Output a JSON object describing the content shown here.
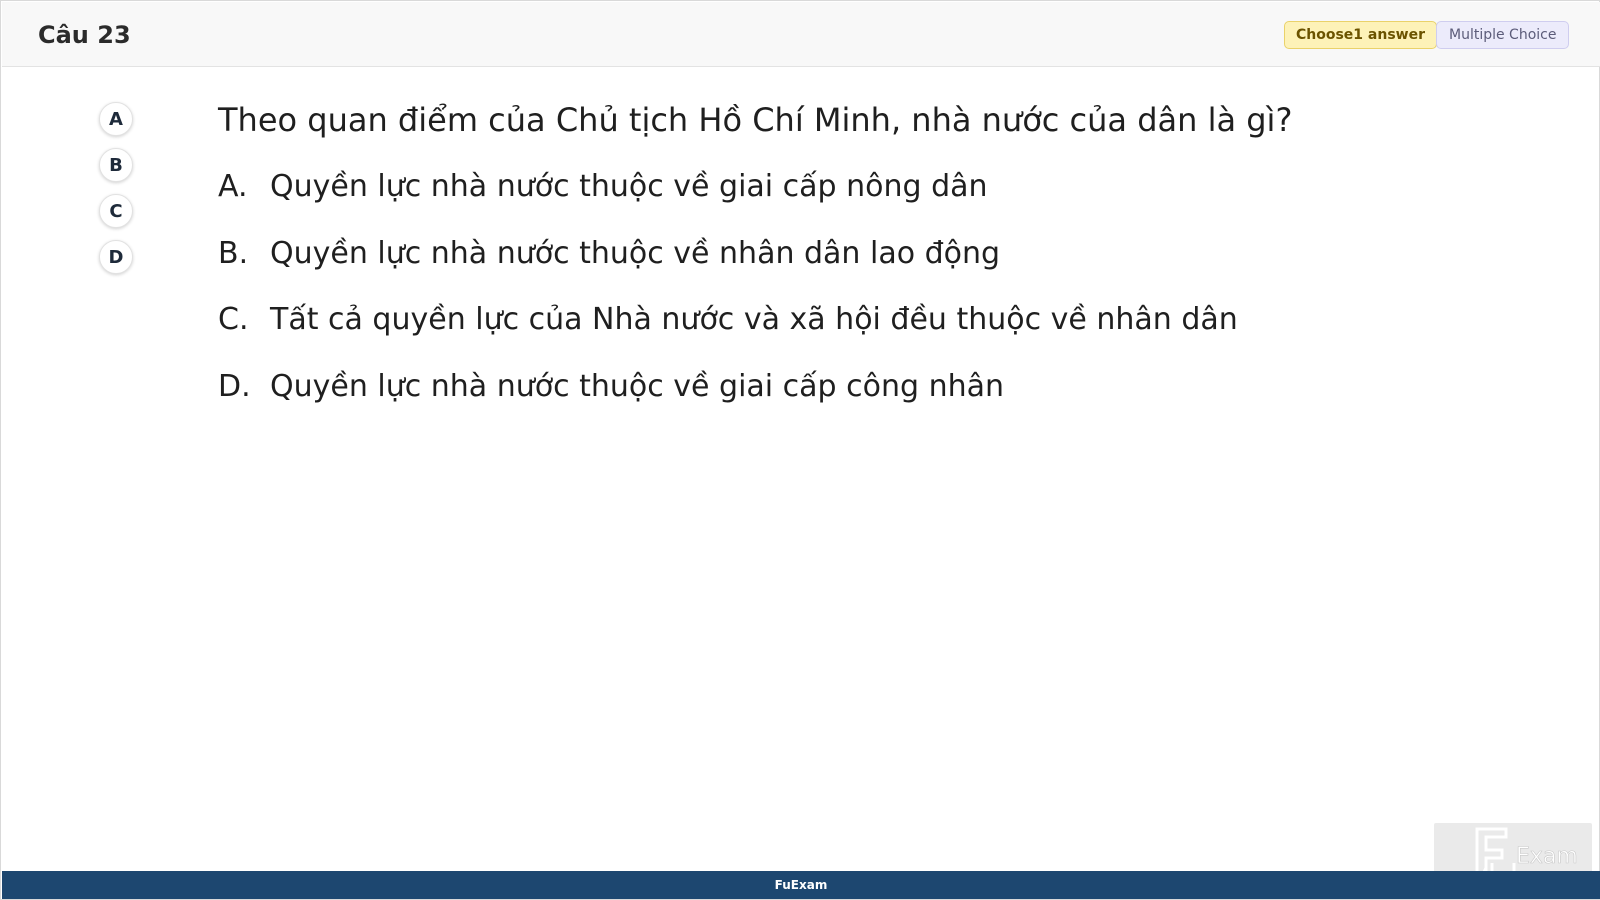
{
  "header": {
    "title": "Câu 23",
    "choose_badge": "Choose1 answer",
    "type_badge": "Multiple Choice"
  },
  "option_buttons": [
    "A",
    "B",
    "C",
    "D"
  ],
  "question": {
    "text": "Theo quan điểm của Chủ tịch Hồ Chí Minh, nhà nước của dân là gì?"
  },
  "answers": [
    {
      "letter": "A.",
      "text": "Quyền lực nhà nước thuộc về giai cấp nông dân"
    },
    {
      "letter": "B.",
      "text": "Quyền lực nhà nước thuộc về nhân dân lao động"
    },
    {
      "letter": "C.",
      "text": "Tất cả quyền lực của Nhà nước và xã hội đều thuộc về nhân dân"
    },
    {
      "letter": "D.",
      "text": "Quyền lực nhà nước thuộc về giai cấp công nhân"
    }
  ],
  "footer": {
    "brand": "FuExam"
  },
  "watermark": {
    "logo_text": "FU Exam",
    "icon": "fuexam-logo-icon"
  }
}
